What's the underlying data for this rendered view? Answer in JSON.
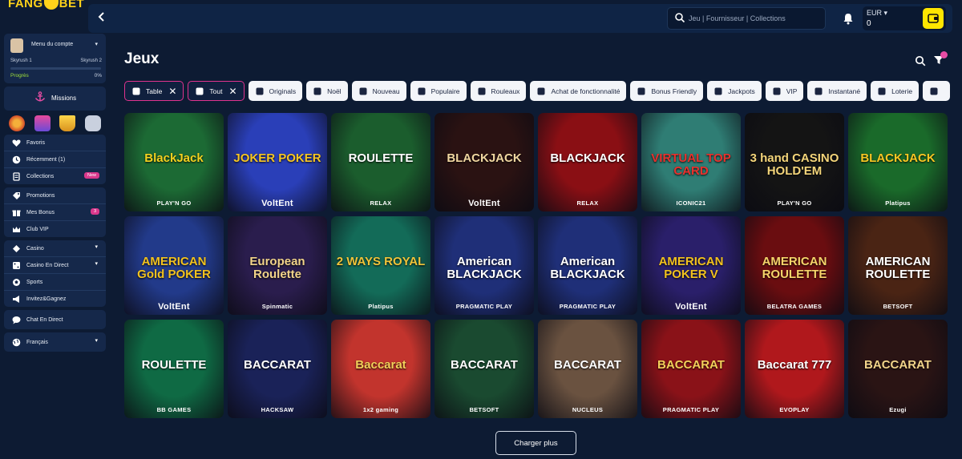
{
  "brand": {
    "logo_left": "FANG",
    "logo_right": "BET"
  },
  "header": {
    "search_placeholder": "Jeu | Fournisseur | Collections",
    "currency": "EUR",
    "balance": "0"
  },
  "sidebar": {
    "account_menu": "Menu du compte",
    "level_left": "Skyrush 1",
    "level_right": "Skyrush 2",
    "progress_label": "Progrès",
    "progress_value": "0%",
    "progress_fraction": 0,
    "missions": "Missions",
    "group1": [
      {
        "label": "Favoris",
        "icon": "heart-icon"
      },
      {
        "label": "Récemment (1)",
        "icon": "clock-icon"
      },
      {
        "label": "Collections",
        "icon": "collections-icon",
        "badge": "New"
      }
    ],
    "group2": [
      {
        "label": "Promotions",
        "icon": "promo-icon"
      },
      {
        "label": "Mes Bonus",
        "icon": "gift-icon",
        "badge": "3"
      },
      {
        "label": "Club VIP",
        "icon": "crown-icon"
      }
    ],
    "group3": [
      {
        "label": "Casino",
        "icon": "casino-icon",
        "chevron": true
      },
      {
        "label": "Casino En Direct",
        "icon": "live-casino-icon",
        "chevron": true
      },
      {
        "label": "Sports",
        "icon": "sports-icon"
      },
      {
        "label": "Invitez&Gagnez",
        "icon": "megaphone-icon"
      }
    ],
    "chat": "Chat En Direct",
    "language": "Français"
  },
  "main": {
    "title": "Jeux",
    "filters": [
      {
        "label": "Table",
        "active": true,
        "icon": "books-icon"
      },
      {
        "label": "Tout",
        "active": true,
        "icon": "grid-icon"
      },
      {
        "label": "Originals",
        "active": false,
        "icon": "diamond-icon"
      },
      {
        "label": "Noël",
        "active": false,
        "icon": "sleigh-icon"
      },
      {
        "label": "Nouveau",
        "active": false,
        "icon": "new-icon"
      },
      {
        "label": "Populaire",
        "active": false,
        "icon": "fire-icon"
      },
      {
        "label": "Rouleaux",
        "active": false,
        "icon": "diamond-icon"
      },
      {
        "label": "Achat de fonctionnalité",
        "active": false,
        "icon": "buy-icon"
      },
      {
        "label": "Bonus Friendly",
        "active": false,
        "icon": "bonus-icon"
      },
      {
        "label": "Jackpots",
        "active": false,
        "icon": "seven-icon"
      },
      {
        "label": "VIP",
        "active": false,
        "icon": "crown-icon"
      },
      {
        "label": "Instantané",
        "active": false,
        "icon": "speed-icon"
      },
      {
        "label": "Loterie",
        "active": false,
        "icon": "lottery-icon"
      },
      {
        "label": "",
        "active": false,
        "icon": "car-icon"
      }
    ],
    "games": [
      {
        "name": "BlackJack",
        "provider": "PLAY'N GO",
        "bg": "#1c6a34",
        "fg": "#f3d21f"
      },
      {
        "name": "JOKER POKER",
        "provider": "VoltEnt",
        "bg": "#2a3fb8",
        "fg": "#f7c623"
      },
      {
        "name": "ROULETTE",
        "provider": "RELAX",
        "bg": "#1b5d2d",
        "fg": "#ffffff"
      },
      {
        "name": "BLACKJACK",
        "provider": "VoltEnt",
        "bg": "#2a1212",
        "fg": "#f0d6a0"
      },
      {
        "name": "BLACKJACK",
        "provider": "RELAX",
        "bg": "#8a0f14",
        "fg": "#ffffff"
      },
      {
        "name": "VIRTUAL TOP CARD",
        "provider": "ICONIC21",
        "bg": "#2f7d74",
        "fg": "#e8312d"
      },
      {
        "name": "3 hand CASINO HOLD'EM",
        "provider": "PLAY'N GO",
        "bg": "#141414",
        "fg": "#f4d57a"
      },
      {
        "name": "BLACKJACK",
        "provider": "Platipus",
        "bg": "#1a6a2a",
        "fg": "#f7c623"
      },
      {
        "name": "AMERICAN Gold POKER",
        "provider": "VoltEnt",
        "bg": "#223a8a",
        "fg": "#f2c21f"
      },
      {
        "name": "European Roulette",
        "provider": "Spinmatic",
        "bg": "#2a1d4d",
        "fg": "#f2d48a"
      },
      {
        "name": "2 WAYS ROYAL",
        "provider": "Platipus",
        "bg": "#136b58",
        "fg": "#f0c43a"
      },
      {
        "name": "American BLACKJACK",
        "provider": "PRAGMATIC PLAY",
        "bg": "#1f2f78",
        "fg": "#ffffff"
      },
      {
        "name": "American BLACKJACK",
        "provider": "PRAGMATIC PLAY",
        "bg": "#1f2f78",
        "fg": "#ffffff"
      },
      {
        "name": "AMERICAN POKER V",
        "provider": "VoltEnt",
        "bg": "#2a1f6a",
        "fg": "#f2c21f"
      },
      {
        "name": "AMERICAN ROULETTE",
        "provider": "BELATRA GAMES",
        "bg": "#6a0d10",
        "fg": "#f6d46a"
      },
      {
        "name": "AMERICAN ROULETTE",
        "provider": "BETSOFT",
        "bg": "#4a2414",
        "fg": "#ffffff"
      },
      {
        "name": "ROULETTE",
        "provider": "BB GAMES",
        "bg": "#0f6a44",
        "fg": "#ffffff"
      },
      {
        "name": "BACCARAT",
        "provider": "HACKSAW",
        "bg": "#1a2258",
        "fg": "#ffffff"
      },
      {
        "name": "Baccarat",
        "provider": "1x2 gaming",
        "bg": "#c2342d",
        "fg": "#f3d05a"
      },
      {
        "name": "BACCARAT",
        "provider": "BETSOFT",
        "bg": "#1a4a30",
        "fg": "#ffffff"
      },
      {
        "name": "BACCARAT",
        "provider": "NUCLEUS",
        "bg": "#6a5240",
        "fg": "#ffffff"
      },
      {
        "name": "BACCARAT",
        "provider": "PRAGMATIC PLAY",
        "bg": "#8a1218",
        "fg": "#f3d05a"
      },
      {
        "name": "Baccarat 777",
        "provider": "EVOPLAY",
        "bg": "#b0181c",
        "fg": "#ffffff"
      },
      {
        "name": "BACCARAT",
        "provider": "Ezugi",
        "bg": "#2a1414",
        "fg": "#f2d48a"
      }
    ],
    "load_more": "Charger plus"
  }
}
